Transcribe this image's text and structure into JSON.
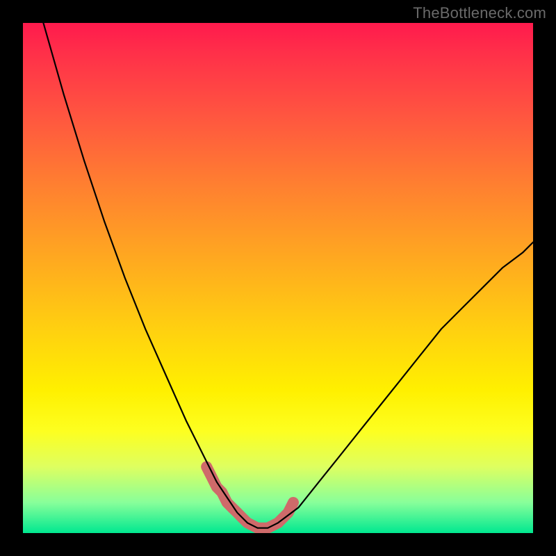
{
  "watermark": "TheBottleneck.com",
  "colors": {
    "frame": "#000000",
    "curve": "#000000",
    "marker": "#cf6a6a",
    "gradient_top": "#ff1a4d",
    "gradient_bottom": "#00e890"
  },
  "chart_data": {
    "type": "line",
    "title": "",
    "xlabel": "",
    "ylabel": "",
    "xlim": [
      0,
      100
    ],
    "ylim": [
      0,
      100
    ],
    "series": [
      {
        "name": "bottleneck-curve",
        "x": [
          4,
          8,
          12,
          16,
          20,
          24,
          28,
          32,
          36,
          38,
          40,
          42,
          44,
          46,
          48,
          50,
          54,
          58,
          62,
          66,
          70,
          74,
          78,
          82,
          86,
          90,
          94,
          98,
          100
        ],
        "y": [
          100,
          86,
          73,
          61,
          50,
          40,
          31,
          22,
          14,
          10,
          7,
          4,
          2,
          1,
          1,
          2,
          5,
          10,
          15,
          20,
          25,
          30,
          35,
          40,
          44,
          48,
          52,
          55,
          57
        ]
      }
    ],
    "markers": {
      "name": "highlighted-region",
      "x": [
        36,
        37,
        38,
        39,
        40,
        41,
        42,
        43,
        44,
        45,
        46,
        47,
        48,
        49,
        50,
        51,
        52,
        53
      ],
      "y": [
        13,
        11,
        9,
        8,
        6,
        5,
        4,
        3,
        2,
        1.5,
        1,
        1,
        1,
        1.5,
        2,
        3,
        4,
        6
      ]
    }
  }
}
